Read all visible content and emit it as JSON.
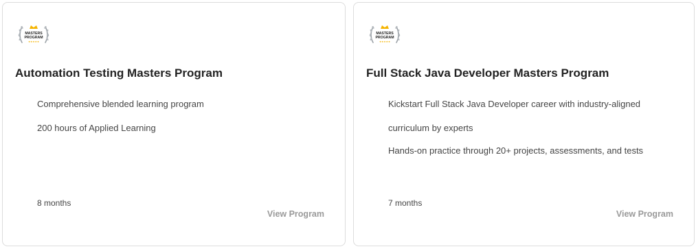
{
  "cards": [
    {
      "badge": {
        "line1": "MASTERS",
        "line2": "PROGRAM",
        "stars": "★★★★★"
      },
      "title": "Automation Testing Masters Program",
      "bullets": [
        "Comprehensive blended learning program",
        "200 hours of Applied Learning"
      ],
      "duration": "8 months",
      "cta": "View Program"
    },
    {
      "badge": {
        "line1": "MASTERS",
        "line2": "PROGRAM",
        "stars": "★★★★★"
      },
      "title": "Full Stack Java Developer Masters Program",
      "bullets": [
        {
          "line1": "Kickstart Full Stack Java Developer career with industry-aligned",
          "line2": "curriculum by experts"
        },
        "Hands-on practice through 20+ projects, assessments, and tests"
      ],
      "duration": "7 months",
      "cta": "View Program"
    }
  ],
  "colors": {
    "border": "#dcdcdc",
    "title": "#222222",
    "text": "#444444",
    "cta": "#9a9a9a",
    "crown": "#f5b400",
    "laurel": "#9aa0a6"
  }
}
